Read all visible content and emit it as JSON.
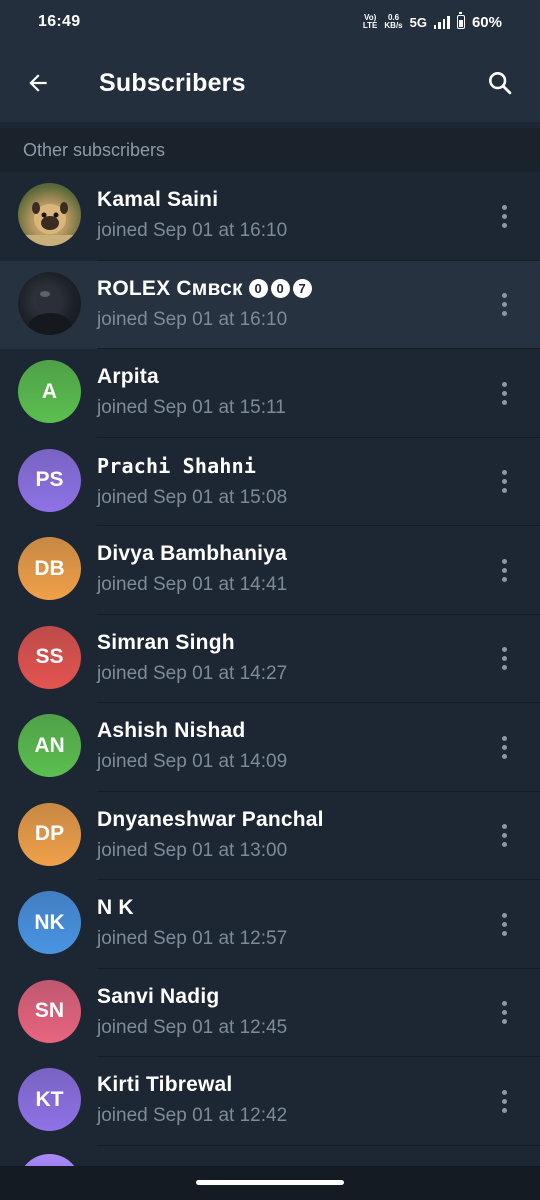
{
  "status_bar": {
    "time": "16:49",
    "volte": "Vo)",
    "lte": "LTE",
    "speed_value": "0.6",
    "speed_unit": "KB/s",
    "network": "5G",
    "battery": "60%"
  },
  "header": {
    "back_icon": "arrow-left-icon",
    "title": "Subscribers",
    "search_icon": "search-icon"
  },
  "section": {
    "title": "Other subscribers"
  },
  "subscribers": [
    {
      "name": "Kamal Saini",
      "status": "joined Sep 01 at 16:10",
      "initials": "",
      "avatar": "photo-pug",
      "color": "#6b5a3e"
    },
    {
      "name": "ROLEX Смвск",
      "status": "joined Sep 01 at 16:10",
      "initials": "",
      "avatar": "photo-dark",
      "color": "#1b2026",
      "badges": [
        "0",
        "0",
        "7"
      ]
    },
    {
      "name": "Arpita",
      "status": "joined Sep 01 at 15:11",
      "initials": "A",
      "color": "#5bbf4e"
    },
    {
      "name": "Prachi Shahni",
      "status": "joined Sep 01 at 15:08",
      "initials": "PS",
      "color": "#8f72e6"
    },
    {
      "name": "Divya Bambhaniya",
      "status": "joined Sep 01 at 14:41",
      "initials": "DB",
      "color": "#f0a048"
    },
    {
      "name": "Simran Singh",
      "status": "joined Sep 01 at 14:27",
      "initials": "SS",
      "color": "#e4544f"
    },
    {
      "name": "Ashish Nishad",
      "status": "joined Sep 01 at 14:09",
      "initials": "AN",
      "color": "#5bbf4e"
    },
    {
      "name": "Dnyaneshwar Panchal",
      "status": "joined Sep 01 at 13:00",
      "initials": "DP",
      "color": "#f0a048"
    },
    {
      "name": "N K",
      "status": "joined Sep 01 at 12:57",
      "initials": "NK",
      "color": "#4a94e4"
    },
    {
      "name": "Sanvi Nadig",
      "status": "joined Sep 01 at 12:45",
      "initials": "SN",
      "color": "#e8647f"
    },
    {
      "name": "Kirti Tibrewal",
      "status": "joined Sep 01 at 12:42",
      "initials": "KT",
      "color": "#8f72e6"
    }
  ],
  "colors": {
    "background": "#1d2733",
    "header": "#242f3d",
    "section_bg": "#1a222c",
    "secondary_text": "#7d8b99"
  }
}
